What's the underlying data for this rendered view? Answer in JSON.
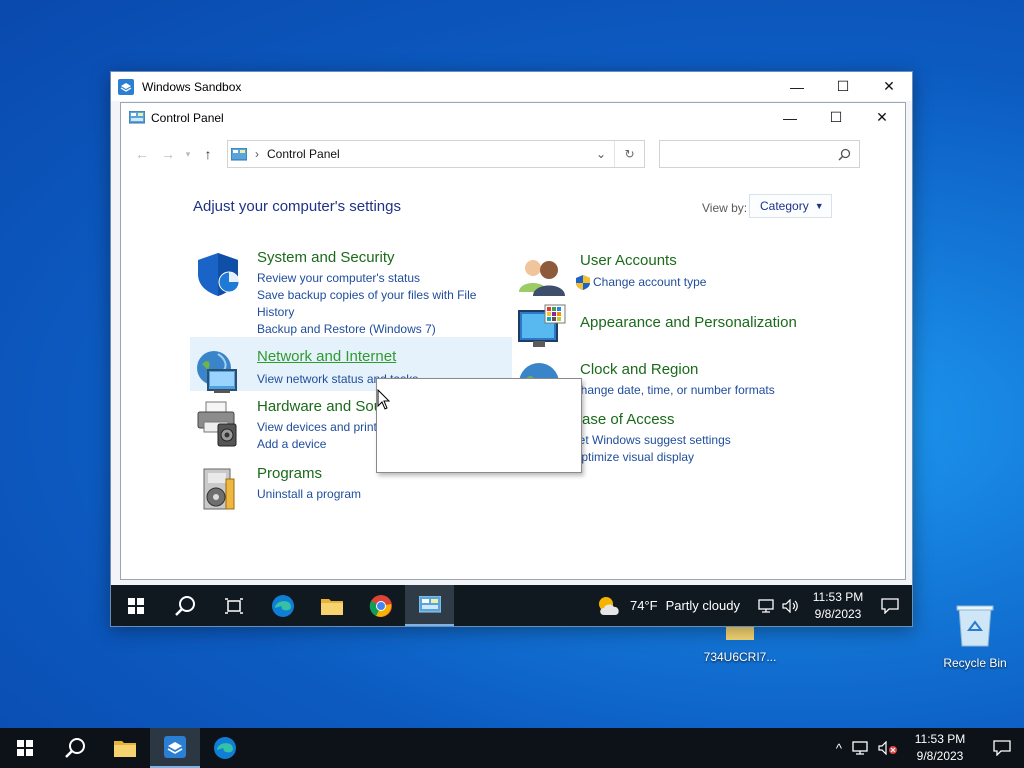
{
  "desktop": {
    "folder_label": "734U6CRI7...",
    "recycle_label": "Recycle Bin"
  },
  "sandbox": {
    "title": "Windows Sandbox",
    "buttons": {
      "minimize": "—",
      "maximize": "☐",
      "close": "✕"
    }
  },
  "control_panel": {
    "title": "Control Panel",
    "breadcrumb": "Control Panel",
    "search_placeholder": "",
    "heading": "Adjust your computer's settings",
    "view_by_label": "View by:",
    "view_by_value": "Category",
    "categories": [
      {
        "title": "System and Security",
        "links": [
          "Review your computer's status",
          "Save backup copies of your files with File History",
          "Backup and Restore (Windows 7)"
        ]
      },
      {
        "title": "Network and Internet",
        "links": [
          "View network status and tasks"
        ]
      },
      {
        "title": "Hardware and Sound",
        "links": [
          "View devices and printers",
          "Add a device"
        ]
      },
      {
        "title": "Programs",
        "links": [
          "Uninstall a program"
        ]
      },
      {
        "title": "User Accounts",
        "links": [
          "Change account type"
        ]
      },
      {
        "title": "Appearance and Personalization",
        "links": []
      },
      {
        "title": "Clock and Region",
        "links": [
          "Change date, time, or number formats"
        ]
      },
      {
        "title": "Ease of Access",
        "links": [
          "Let Windows suggest settings",
          "Optimize visual display"
        ]
      }
    ]
  },
  "inner_taskbar": {
    "temperature": "74°F",
    "weather": "Partly cloudy",
    "time": "11:53 PM",
    "date": "9/8/2023"
  },
  "taskbar": {
    "time": "11:53 PM",
    "date": "9/8/2023"
  },
  "colors": {
    "link_blue": "#1f4d9c",
    "category_green": "#1b6a1b",
    "heading_blue": "#1e3287",
    "hover_bg": "#e6f2fb"
  }
}
